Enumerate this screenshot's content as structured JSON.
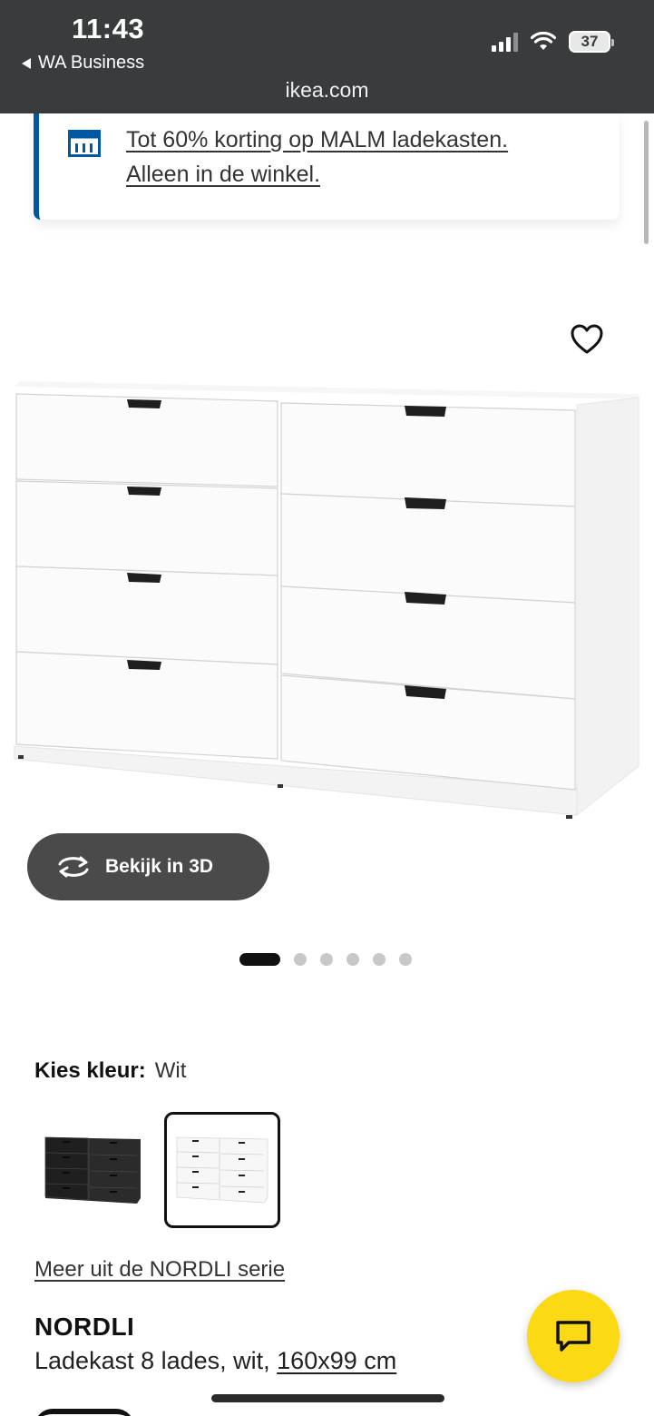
{
  "status_bar": {
    "time": "11:43",
    "back_app": "WA Business",
    "battery": "37",
    "url": "ikea.com"
  },
  "promo": {
    "line1": "Tot 60% korting op MALM ladekasten.",
    "line2": "Alleen in de winkel.",
    "accent_color": "#0058a3",
    "icon": "store-icon"
  },
  "product_view": {
    "view_3d_label": "Bekijk in 3D",
    "carousel_count": 6,
    "carousel_active": 0
  },
  "color_picker": {
    "label": "Kies kleur:",
    "selected": "Wit",
    "options": [
      "antraciet",
      "wit"
    ]
  },
  "series_link": "Meer uit de NORDLI serie",
  "product": {
    "name": "NORDLI",
    "description": "Ladekast 8 lades, wit, ",
    "size": "160x99 cm"
  },
  "chat": {
    "color": "#fbd914",
    "icon": "chat-icon"
  }
}
